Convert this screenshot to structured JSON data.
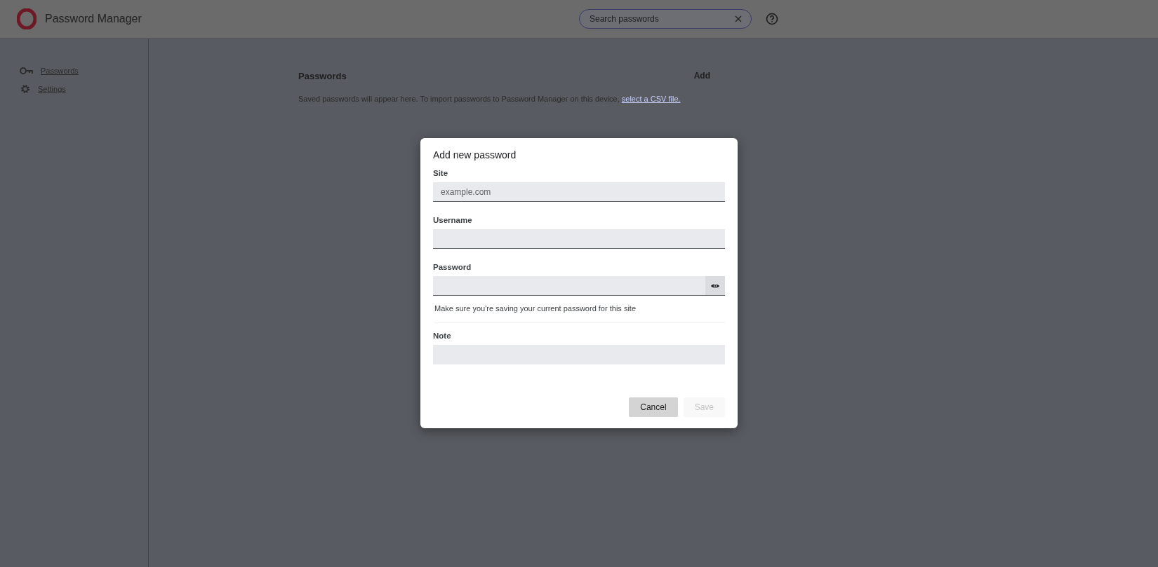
{
  "header": {
    "title": "Password Manager",
    "search": {
      "placeholder": "Search passwords"
    }
  },
  "sidebar": {
    "items": [
      {
        "label": "Passwords",
        "kind": "key"
      },
      {
        "label": "Settings",
        "kind": "gear"
      }
    ]
  },
  "main": {
    "title": "Passwords",
    "add_button": "Add",
    "empty_text": "Saved passwords will appear here. To import passwords to Password Manager on this device,",
    "import_link": "select a CSV file."
  },
  "dialog": {
    "title": "Add new password",
    "fields": [
      {
        "label": "Site",
        "placeholder": "example.com",
        "kind": "text"
      },
      {
        "label": "Username",
        "kind": "text"
      },
      {
        "label": "Password",
        "kind": "password"
      },
      {
        "label": "Note",
        "kind": "note"
      }
    ],
    "hint": "Make sure you're saving your current password for this site",
    "buttons": [
      {
        "label": "Cancel",
        "disabled": false
      },
      {
        "label": "Save",
        "disabled": true
      }
    ]
  }
}
